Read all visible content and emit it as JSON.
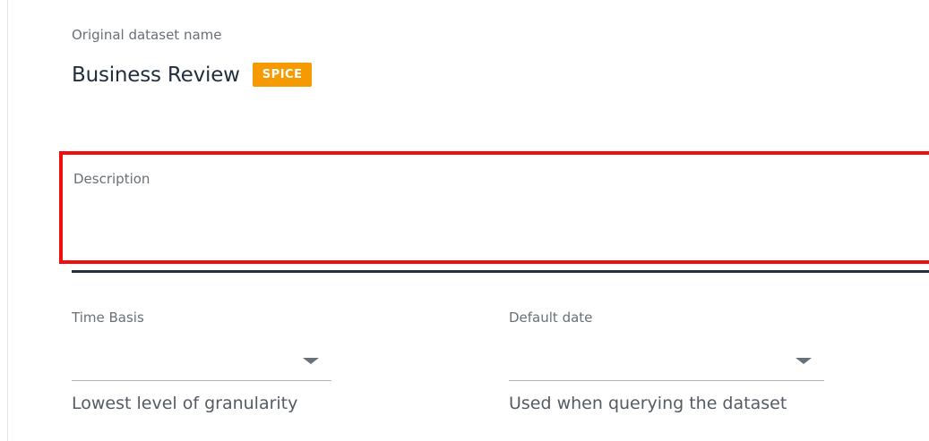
{
  "dataset": {
    "original_name_label": "Original dataset name",
    "name": "Business Review",
    "badge": "SPICE"
  },
  "description": {
    "label": "Description",
    "value": ""
  },
  "time_basis": {
    "label": "Time Basis",
    "value": "",
    "help": "Lowest level of granularity"
  },
  "default_date": {
    "label": "Default date",
    "value": "",
    "help": "Used when querying the dataset"
  },
  "colors": {
    "badge": "#f59a00",
    "highlight": "#ef0f0f",
    "text": "#232f3e",
    "label": "#687078"
  },
  "icons": {
    "dropdown": "caret-down-icon"
  }
}
